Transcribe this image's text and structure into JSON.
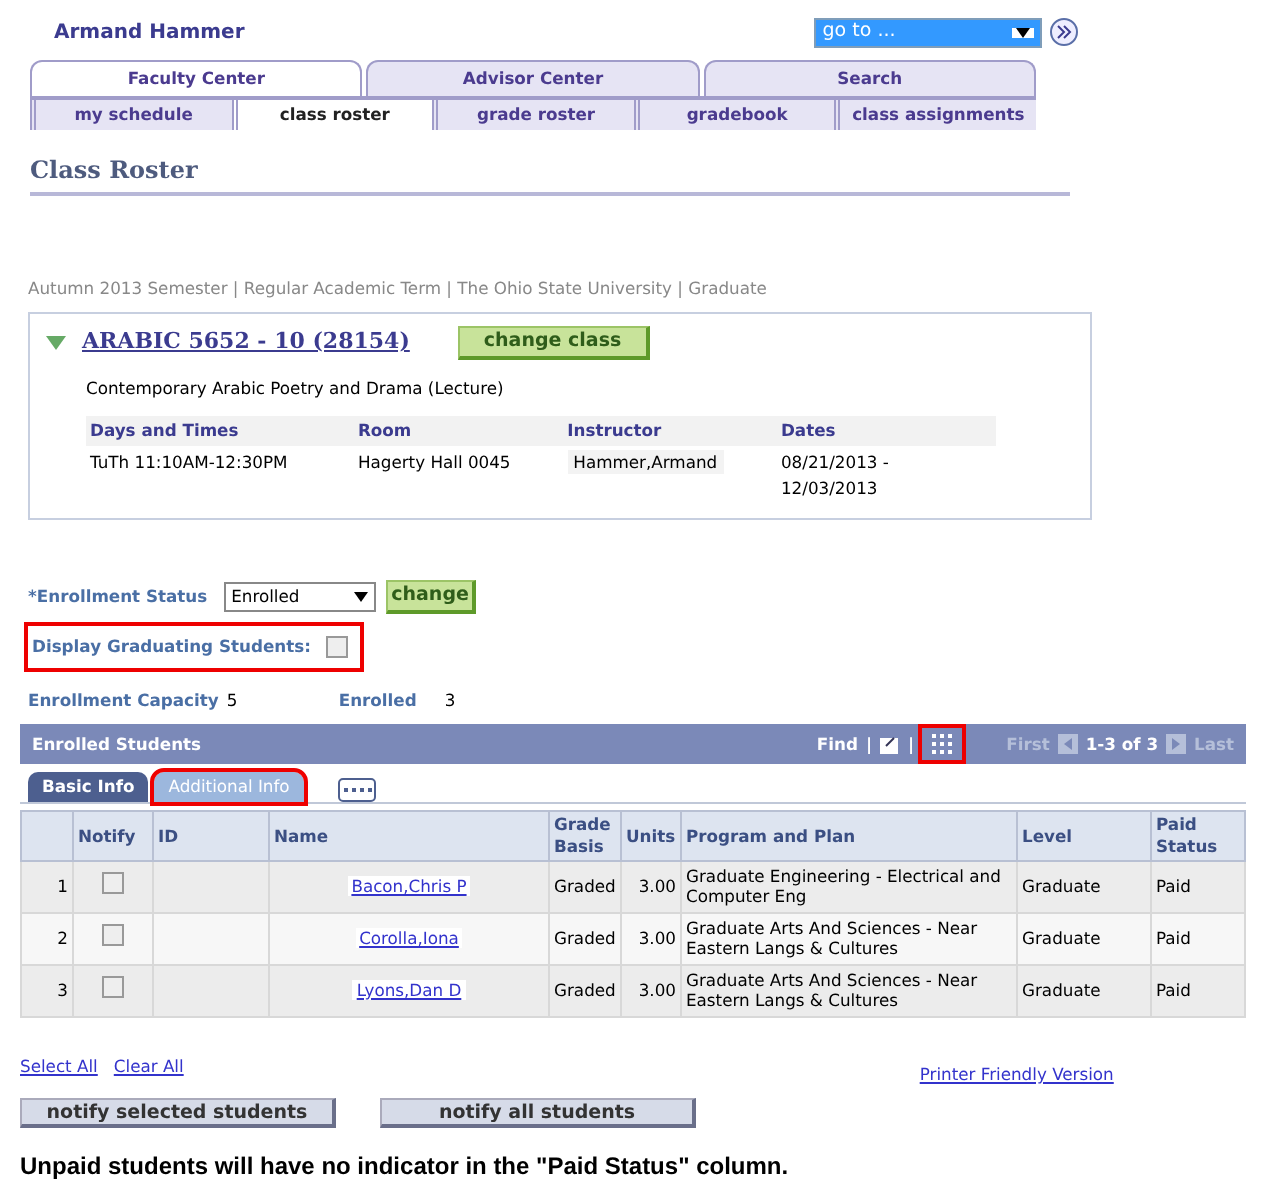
{
  "user_name": "Armand  Hammer",
  "goto": {
    "value": "go to ..."
  },
  "tabs": [
    {
      "label": "Faculty Center",
      "selected": true
    },
    {
      "label": "Advisor Center",
      "selected": false
    },
    {
      "label": "Search",
      "selected": false
    }
  ],
  "subtabs": [
    {
      "label": "my schedule",
      "selected": false
    },
    {
      "label": "class roster",
      "selected": true
    },
    {
      "label": "grade roster",
      "selected": false
    },
    {
      "label": "gradebook",
      "selected": false
    },
    {
      "label": "class assignments",
      "selected": false
    }
  ],
  "page_title": "Class Roster",
  "term_line": "Autumn 2013 Semester | Regular Academic Term | The Ohio State University | Graduate",
  "class": {
    "expanded": true,
    "title": "ARABIC 5652 - 10 (28154)",
    "change_button": "change class",
    "description": "Contemporary Arabic Poetry and Drama (Lecture)",
    "columns": [
      "Days and Times",
      "Room",
      "Instructor",
      "Dates"
    ],
    "row": [
      "TuTh 11:10AM-12:30PM",
      "Hagerty Hall 0045",
      "Hammer,Armand",
      "08/21/2013 - 12/03/2013"
    ]
  },
  "enrollment_status": {
    "label": "*Enrollment Status",
    "value": "Enrolled",
    "button": "change"
  },
  "graduating": {
    "label": "Display Graduating Students:",
    "checked": false,
    "highlighted": true
  },
  "capacity": {
    "label": "Enrollment Capacity",
    "value": "5"
  },
  "enrolled": {
    "label": "Enrolled",
    "value": "3"
  },
  "grid": {
    "title": "Enrolled Students",
    "find": "Find",
    "separator_1": "|",
    "separator_2": "|",
    "view_all_highlighted": true,
    "first": "First",
    "range": "1-3 of 3",
    "last": "Last",
    "tabs": [
      {
        "label": "Basic Info",
        "selected": true,
        "highlighted": false
      },
      {
        "label": "Additional Info",
        "selected": false,
        "highlighted": true
      }
    ],
    "columns": [
      "Notify",
      "ID",
      "Name",
      "Grade Basis",
      "Units",
      "Program and Plan",
      "Level",
      "Paid Status"
    ],
    "rows": [
      {
        "number": "1",
        "checked": false,
        "name": "Bacon,Chris P",
        "grade_basis": "Graded",
        "units": "3.00",
        "program": "Graduate Engineering - Electrical and Computer Eng",
        "level": "Graduate",
        "paid": "Paid"
      },
      {
        "number": "2",
        "checked": false,
        "name": "Corolla,Iona",
        "grade_basis": "Graded",
        "units": "3.00",
        "program": "Graduate Arts And Sciences - Near Eastern Langs & Cultures",
        "level": "Graduate",
        "paid": "Paid"
      },
      {
        "number": "3",
        "checked": false,
        "name": "Lyons,Dan D",
        "grade_basis": "Graded",
        "units": "3.00",
        "program": "Graduate Arts And Sciences - Near Eastern Langs & Cultures",
        "level": "Graduate",
        "paid": "Paid"
      }
    ]
  },
  "links": [
    "Select All",
    "Clear All"
  ],
  "printer_link": "Printer Friendly Version",
  "buttons": [
    "notify selected students",
    "notify all students"
  ],
  "note": "Unpaid students will have no indicator in the \"Paid Status\" column."
}
